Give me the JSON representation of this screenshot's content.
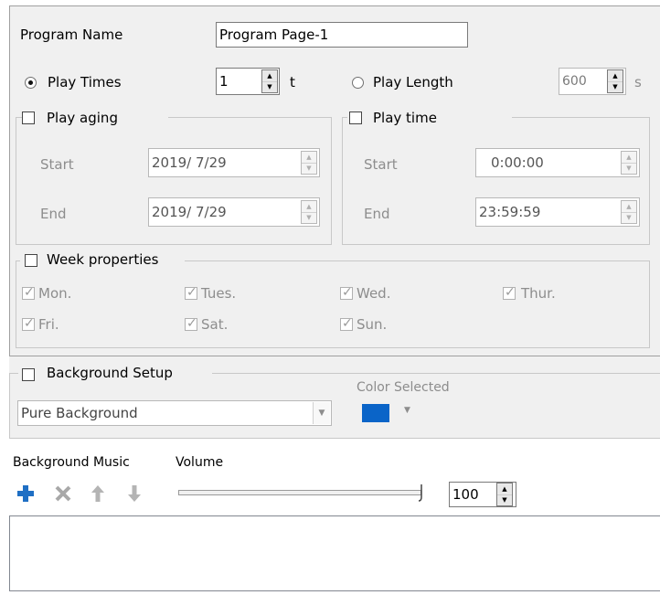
{
  "program": {
    "label": "Program Name",
    "value": "Program Page-1"
  },
  "play_times": {
    "label": "Play Times",
    "value": "1",
    "unit": "t",
    "selected": true
  },
  "play_length": {
    "label": "Play Length",
    "value": "600",
    "unit": "s",
    "selected": false
  },
  "play_aging": {
    "label": "Play aging",
    "checked": false,
    "start_label": "Start",
    "start_value": "2019/ 7/29",
    "end_label": "End",
    "end_value": "2019/ 7/29"
  },
  "play_time": {
    "label": "Play time",
    "checked": false,
    "start_label": "Start",
    "start_value": "0:00:00",
    "end_label": "End",
    "end_value": "23:59:59"
  },
  "week": {
    "label": "Week properties",
    "checked": false,
    "days": [
      "Mon.",
      "Tues.",
      "Wed.",
      "Thur.",
      "Fri.",
      "Sat.",
      "Sun."
    ]
  },
  "background": {
    "label": "Background Setup",
    "checked": false,
    "type_value": "Pure Background",
    "color_label": "Color Selected",
    "color": "#0a64c8"
  },
  "music": {
    "label": "Background Music",
    "volume_label": "Volume",
    "volume_value": "100",
    "volume_level": 1.0,
    "icons": [
      "add-icon",
      "delete-icon",
      "move-up-icon",
      "move-down-icon"
    ]
  }
}
